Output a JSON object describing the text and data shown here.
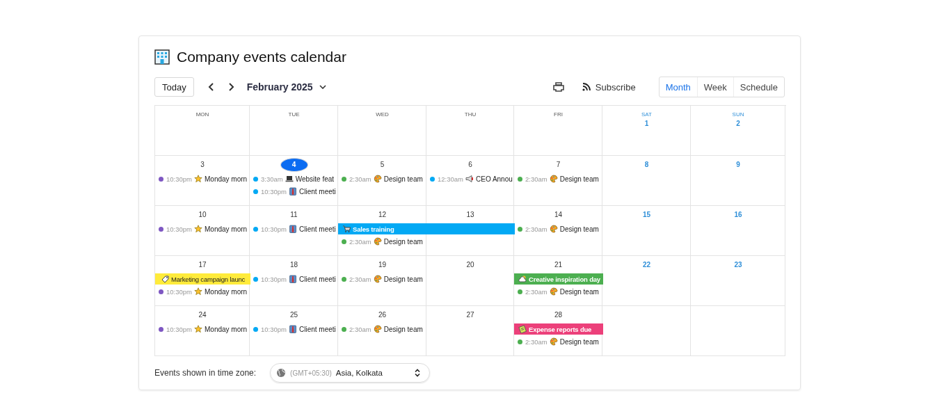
{
  "title": "Company events calendar",
  "toolbar": {
    "today": "Today",
    "month_label": "February 2025",
    "subscribe": "Subscribe"
  },
  "views": [
    {
      "label": "Month",
      "selected": true
    },
    {
      "label": "Week",
      "selected": false
    },
    {
      "label": "Schedule",
      "selected": false
    }
  ],
  "weekdays": [
    {
      "label": "MON",
      "weekend": false
    },
    {
      "label": "TUE",
      "weekend": false
    },
    {
      "label": "WED",
      "weekend": false
    },
    {
      "label": "THU",
      "weekend": false
    },
    {
      "label": "FRI",
      "weekend": false
    },
    {
      "label": "SAT",
      "weekend": true
    },
    {
      "label": "SUN",
      "weekend": true
    }
  ],
  "weeks": [
    {
      "days": [
        {
          "kind": "blank"
        },
        {
          "kind": "blank"
        },
        {
          "kind": "blank"
        },
        {
          "kind": "blank"
        },
        {
          "kind": "blank"
        },
        {
          "kind": "day",
          "date": "1",
          "weekend": true,
          "today": false
        },
        {
          "kind": "day",
          "date": "2",
          "weekend": true,
          "today": false
        }
      ]
    },
    {
      "days": [
        {
          "kind": "day",
          "date": "3",
          "weekend": false,
          "today": false,
          "events": [
            {
              "kind": "star",
              "all_day": false,
              "time": "10:30pm",
              "title": "Monday morn",
              "color": "#7e57c2"
            }
          ]
        },
        {
          "kind": "day",
          "date": "4",
          "weekend": false,
          "today": true,
          "events": [
            {
              "kind": "laptop",
              "all_day": false,
              "time": "3:30am",
              "title": "Website feat",
              "color": "#03a9f4"
            },
            {
              "kind": "jacket",
              "all_day": false,
              "time": "10:30pm",
              "title": "Client meeti",
              "color": "#03a9f4"
            }
          ]
        },
        {
          "kind": "day",
          "date": "5",
          "weekend": false,
          "today": false,
          "events": [
            {
              "kind": "palette",
              "all_day": false,
              "time": "2:30am",
              "title": "Design team",
              "color": "#4caf50"
            }
          ]
        },
        {
          "kind": "day",
          "date": "6",
          "weekend": false,
          "today": false,
          "events": [
            {
              "kind": "megaphone",
              "all_day": false,
              "time": "12:30am",
              "title": "CEO Annou",
              "color": "#03a9f4"
            }
          ]
        },
        {
          "kind": "day",
          "date": "7",
          "weekend": false,
          "today": false,
          "events": [
            {
              "kind": "palette",
              "all_day": false,
              "time": "2:30am",
              "title": "Design team",
              "color": "#4caf50"
            }
          ]
        },
        {
          "kind": "day",
          "date": "8",
          "weekend": true,
          "today": false
        },
        {
          "kind": "day",
          "date": "9",
          "weekend": true,
          "today": false
        }
      ]
    },
    {
      "days": [
        {
          "kind": "day",
          "date": "10",
          "weekend": false,
          "today": false,
          "events": [
            {
              "kind": "star",
              "all_day": false,
              "time": "10:30pm",
              "title": "Monday morn",
              "color": "#7e57c2"
            }
          ]
        },
        {
          "kind": "day",
          "date": "11",
          "weekend": false,
          "today": false,
          "events": [
            {
              "kind": "jacket",
              "all_day": false,
              "time": "10:30pm",
              "title": "Client meeti",
              "color": "#03a9f4"
            }
          ]
        },
        {
          "kind": "day",
          "date": "12",
          "weekend": false,
          "today": false,
          "events": [
            {
              "kind": "cart",
              "all_day": true,
              "title": "Sales training",
              "color": "#03a9f4"
            },
            {
              "kind": "palette",
              "all_day": false,
              "time": "2:30am",
              "title": "Design team",
              "color": "#4caf50"
            }
          ]
        },
        {
          "kind": "day",
          "date": "13",
          "weekend": false,
          "today": false,
          "events": [
            {
              "kind": "continuation"
            }
          ]
        },
        {
          "kind": "day",
          "date": "14",
          "weekend": false,
          "today": false,
          "events": [
            {
              "kind": "palette",
              "all_day": false,
              "time": "2:30am",
              "title": "Design team",
              "color": "#4caf50"
            }
          ]
        },
        {
          "kind": "day",
          "date": "15",
          "weekend": true,
          "today": false
        },
        {
          "kind": "day",
          "date": "16",
          "weekend": true,
          "today": false
        }
      ]
    },
    {
      "days": [
        {
          "kind": "day",
          "date": "17",
          "weekend": false,
          "today": false,
          "events": [
            {
              "kind": "tag",
              "all_day": true,
              "title": "Marketing campaign launc",
              "color": "#ffeb3b"
            },
            {
              "kind": "star",
              "all_day": false,
              "time": "10:30pm",
              "title": "Monday morn",
              "color": "#7e57c2"
            }
          ]
        },
        {
          "kind": "day",
          "date": "18",
          "weekend": false,
          "today": false,
          "events": [
            {
              "kind": "jacket",
              "all_day": false,
              "time": "10:30pm",
              "title": "Client meeti",
              "color": "#03a9f4"
            }
          ]
        },
        {
          "kind": "day",
          "date": "19",
          "weekend": false,
          "today": false,
          "events": [
            {
              "kind": "palette",
              "all_day": false,
              "time": "2:30am",
              "title": "Design team",
              "color": "#4caf50"
            }
          ]
        },
        {
          "kind": "day",
          "date": "20",
          "weekend": false,
          "today": false
        },
        {
          "kind": "day",
          "date": "21",
          "weekend": false,
          "today": false,
          "events": [
            {
              "kind": "cloud",
              "all_day": true,
              "title": "Creative inspiration day",
              "color": "#4caf50"
            },
            {
              "kind": "palette",
              "all_day": false,
              "time": "2:30am",
              "title": "Design team",
              "color": "#4caf50"
            }
          ]
        },
        {
          "kind": "day",
          "date": "22",
          "weekend": true,
          "today": false
        },
        {
          "kind": "day",
          "date": "23",
          "weekend": true,
          "today": false
        }
      ]
    },
    {
      "days": [
        {
          "kind": "day",
          "date": "24",
          "weekend": false,
          "today": false,
          "events": [
            {
              "kind": "star",
              "all_day": false,
              "time": "10:30pm",
              "title": "Monday morn",
              "color": "#7e57c2"
            }
          ]
        },
        {
          "kind": "day",
          "date": "25",
          "weekend": false,
          "today": false,
          "events": [
            {
              "kind": "jacket",
              "all_day": false,
              "time": "10:30pm",
              "title": "Client meeti",
              "color": "#03a9f4"
            }
          ]
        },
        {
          "kind": "day",
          "date": "26",
          "weekend": false,
          "today": false,
          "events": [
            {
              "kind": "palette",
              "all_day": false,
              "time": "2:30am",
              "title": "Design team",
              "color": "#4caf50"
            }
          ]
        },
        {
          "kind": "day",
          "date": "27",
          "weekend": false,
          "today": false
        },
        {
          "kind": "day",
          "date": "28",
          "weekend": false,
          "today": false,
          "events": [
            {
              "kind": "clipboard",
              "all_day": true,
              "title": "Expense reports due",
              "color": "#ec407a"
            },
            {
              "kind": "palette",
              "all_day": false,
              "time": "2:30am",
              "title": "Design team",
              "color": "#4caf50"
            }
          ]
        },
        {
          "kind": "blank"
        },
        {
          "kind": "blank"
        }
      ]
    }
  ],
  "timezone": {
    "label": "Events shown in time zone:",
    "offset": "(GMT+05:30)",
    "value": "Asia, Kolkata"
  }
}
